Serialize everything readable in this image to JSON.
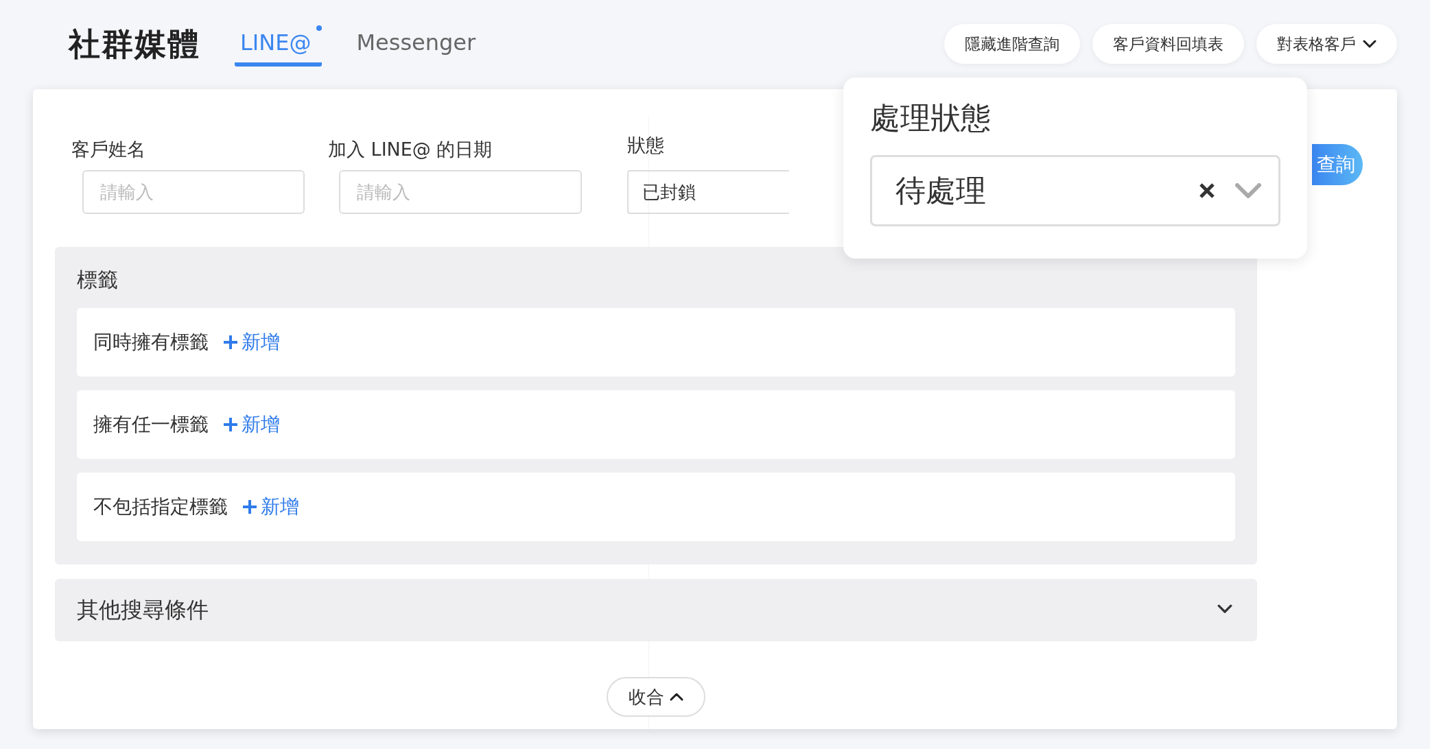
{
  "header": {
    "title": "社群媒體",
    "tabs": [
      {
        "label": "LINE@",
        "selected": true,
        "unread": true
      },
      {
        "label": "Messenger",
        "selected": false,
        "unread": false
      }
    ],
    "actions": [
      {
        "label": "隱藏進階查詢",
        "kind": "plain"
      },
      {
        "label": "客戶資料回填表",
        "kind": "plain"
      },
      {
        "label": "對表格客戶",
        "kind": "dropdown"
      }
    ]
  },
  "form": {
    "fields": [
      {
        "label": "客戶姓名",
        "placeholder": "請輸入"
      },
      {
        "label": "加入 LINE@ 的日期",
        "placeholder": "請輸入"
      }
    ],
    "status": {
      "label": "狀態",
      "value": "已封鎖"
    },
    "query_button": "查詢"
  },
  "tags": {
    "title": "標籤",
    "rows": [
      {
        "label": "同時擁有標籤",
        "add": "新增"
      },
      {
        "label": "擁有任一標籤",
        "add": "新增"
      },
      {
        "label": "不包括指定標籤",
        "add": "新增"
      }
    ]
  },
  "other_conditions": {
    "label": "其他搜尋條件",
    "expanded": false
  },
  "collapse_button": "收合",
  "popup": {
    "title": "處理狀態",
    "value": "待處理"
  }
}
